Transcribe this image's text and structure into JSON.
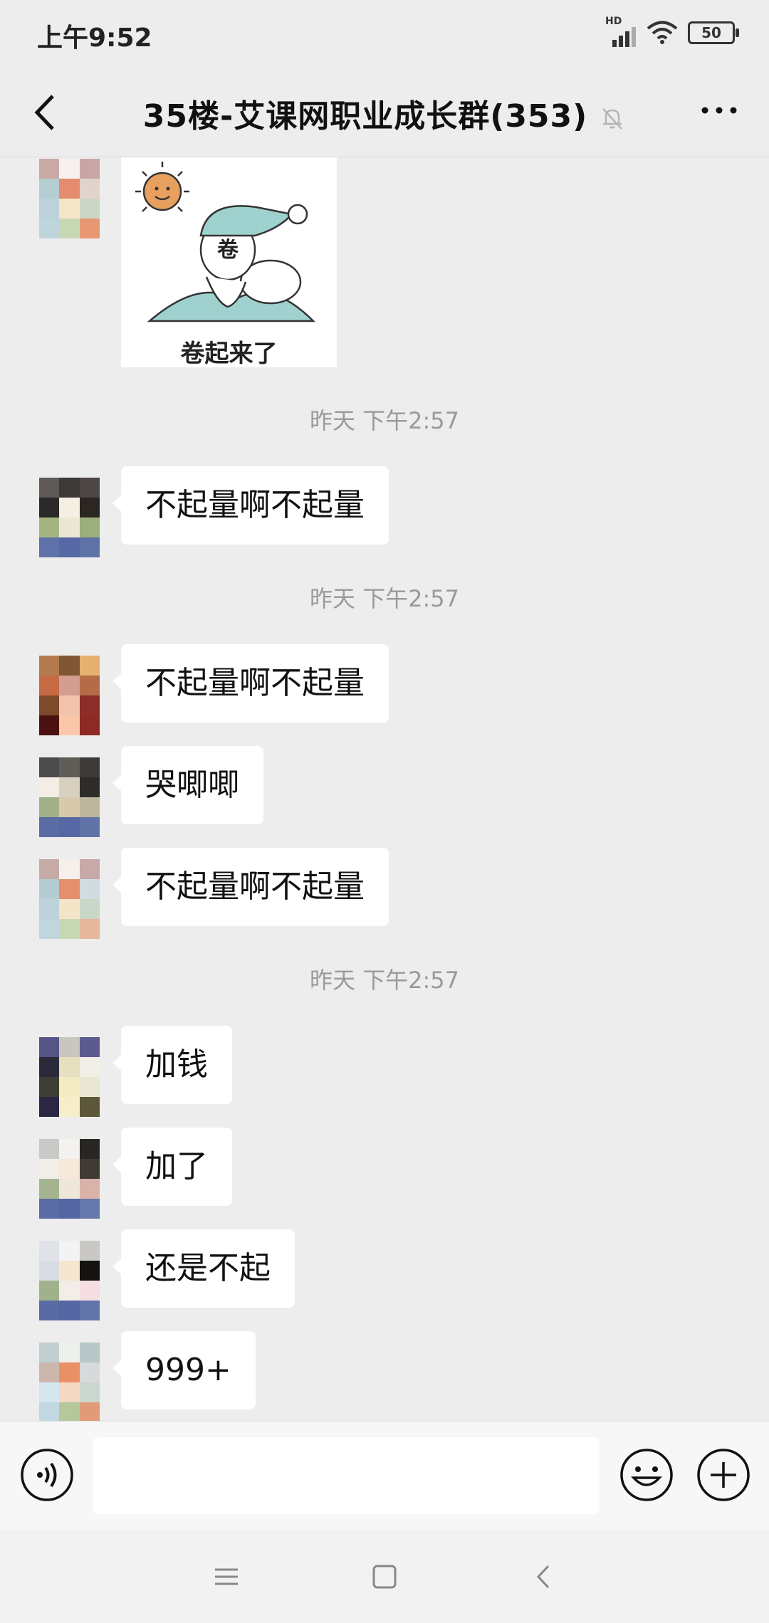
{
  "status_bar": {
    "time": "上午9:52",
    "network_label": "HD",
    "battery": "50"
  },
  "header": {
    "title": "35楼-艾课网职业成长群(353)",
    "icons": [
      "back-arrow-icon",
      "muted-bell-icon",
      "more-dots-icon"
    ]
  },
  "messages": [
    {
      "type": "sticker",
      "caption": "卷起来了",
      "sticker_glyph": "卷"
    },
    {
      "type": "time",
      "text": "昨天 下午2:57"
    },
    {
      "type": "text",
      "text": "不起量啊不起量"
    },
    {
      "type": "time",
      "text": "昨天 下午2:57"
    },
    {
      "type": "text",
      "text": "不起量啊不起量"
    },
    {
      "type": "text",
      "text": "哭唧唧"
    },
    {
      "type": "text",
      "text": "不起量啊不起量"
    },
    {
      "type": "time",
      "text": "昨天 下午2:57"
    },
    {
      "type": "text",
      "text": "加钱"
    },
    {
      "type": "text",
      "text": "加了"
    },
    {
      "type": "text",
      "text": "还是不起"
    },
    {
      "type": "text",
      "text": "999+"
    }
  ],
  "input_bar": {
    "placeholder": "",
    "icons": [
      "voice-icon",
      "emoji-icon",
      "plus-icon"
    ]
  },
  "system_nav": {
    "icons": [
      "menu-icon",
      "home-icon",
      "back-icon"
    ]
  },
  "colors": {
    "chat_background": "#ededed",
    "bubble": "#ffffff",
    "time_label": "#9a9a9a"
  }
}
